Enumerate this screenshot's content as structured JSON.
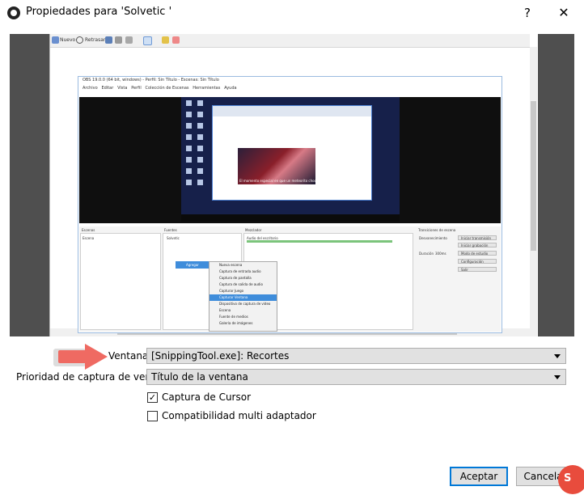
{
  "window": {
    "title": "Propiedades para 'Solvetic '",
    "help_glyph": "?",
    "close_glyph": "✕"
  },
  "preview": {
    "toolbar": {
      "new_label": "Nuevo",
      "delay_label": "Retrasar"
    },
    "obs_window": {
      "title": "OBS 19.0.0 (64 bit, windows) - Perfil: Sin Título - Escenas: Sin Título",
      "menu": [
        "Archivo",
        "Editar",
        "Vista",
        "Perfil",
        "Colección de Escenas",
        "Herramientas",
        "Ayuda"
      ],
      "browser_image_caption": "El momento especial en que un meteorito choca",
      "docks": {
        "scenes_title": "Escenas",
        "scenes_item": "Escena",
        "sources_title": "Fuentes",
        "sources_item": "Solvetic",
        "mixer_title": "Mezclador",
        "mixer_item": "Audio del escritorio",
        "transitions_title": "Transiciones de escena",
        "transition_value": "Desvanecimiento",
        "duration_label": "Duración",
        "duration_value": "300ms",
        "controls": [
          "Iniciar transmisión",
          "Iniciar grabación",
          "Modo de estudio",
          "Configuración",
          "Salir"
        ]
      },
      "context_menu": {
        "submenu_label": "Agregar",
        "items": [
          "Nueva escena",
          "Captura de entrada audio",
          "Captura de pantalla",
          "Captura de salida de audio",
          "Capturar Juego",
          "Capturar Ventana",
          "Dispositivo de captura de video",
          "Escena",
          "Fuente de medios",
          "Galería de imágenes"
        ],
        "highlighted_index": 5
      }
    }
  },
  "form": {
    "window_label": "Ventana",
    "window_value": "[SnippingTool.exe]: Recortes",
    "priority_label": "Prioridad de captura de ventana",
    "priority_value": "Título de la ventana",
    "capture_cursor_label": "Captura de Cursor",
    "capture_cursor_checked": true,
    "multi_adapter_label": "Compatibilidad multi adaptador",
    "multi_adapter_checked": false
  },
  "buttons": {
    "ok_label": "Aceptar",
    "cancel_label": "Cancelar"
  },
  "watermark": {
    "text": "S"
  },
  "colors": {
    "accent": "#0078d7",
    "arrow": "#ef6a62",
    "preview_bg": "#4a4a4a",
    "highlight": "#3f8ddb"
  }
}
